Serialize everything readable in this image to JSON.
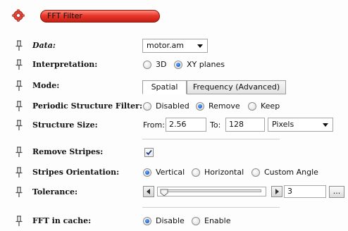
{
  "header": {
    "title": "FFT Filter"
  },
  "rows": {
    "data": {
      "label": "Data:",
      "value": "motor.am"
    },
    "interpretation": {
      "label": "Interpretation:",
      "options": [
        "3D",
        "XY planes"
      ],
      "selected": "XY planes"
    },
    "mode": {
      "label": "Mode:",
      "tabs": [
        "Spatial",
        "Frequency (Advanced)"
      ],
      "active": "Spatial"
    },
    "periodic": {
      "label": "Periodic Structure Filter:",
      "options": [
        "Disabled",
        "Remove",
        "Keep"
      ],
      "selected": "Remove"
    },
    "structure": {
      "label": "Structure Size:",
      "from_label": "From:",
      "from_value": "2.56",
      "to_label": "To:",
      "to_value": "128",
      "unit": "Pixels"
    },
    "remove_stripes": {
      "label": "Remove Stripes:",
      "checked": true
    },
    "stripes_orientation": {
      "label": "Stripes Orientation:",
      "options": [
        "Vertical",
        "Horizontal",
        "Custom Angle"
      ],
      "selected": "Vertical"
    },
    "tolerance": {
      "label": "Tolerance:",
      "value": "3",
      "button": "..."
    },
    "fft_cache": {
      "label": "FFT in cache:",
      "options": [
        "Disable",
        "Enable"
      ],
      "selected": "Disable"
    }
  },
  "icons": {
    "header": "gear-icon",
    "rows": "pin-icon"
  },
  "colors": {
    "title_red": "#e8382b",
    "radio_blue": "#1d5fd0"
  }
}
